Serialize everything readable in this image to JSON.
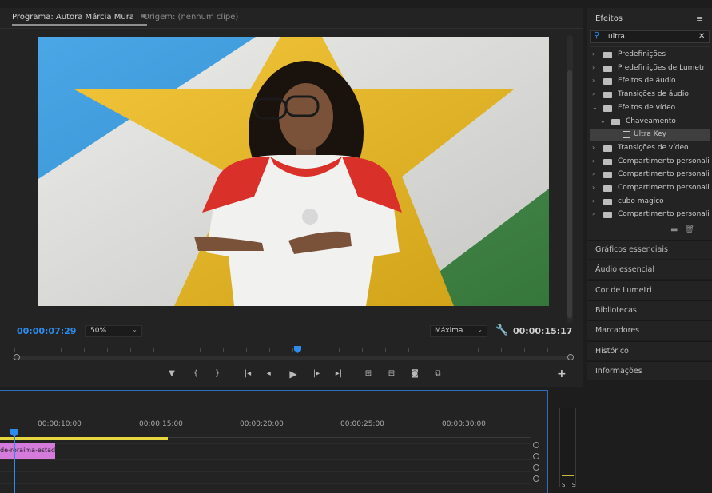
{
  "monitor": {
    "program_tab": "Programa: Autora Márcia Mura",
    "program_menu_icon": "hamburger-menu-icon",
    "source_tab": "Origem: (nenhum clipe)",
    "current_time": "00:00:07:29",
    "zoom": "50%",
    "quality": "Máxima",
    "duration": "00:00:15:17",
    "transport": {
      "icons": [
        "marker-icon",
        "mark-in-icon",
        "mark-out-icon",
        "go-to-in-icon",
        "step-back-icon",
        "play-icon",
        "step-forward-icon",
        "go-to-out-icon",
        "lift-icon",
        "extract-icon",
        "export-frame-icon",
        "comparison-view-icon"
      ],
      "add_icon": "plus-icon"
    }
  },
  "timeline": {
    "labels": [
      "00:00:10:00",
      "00:00:15:00",
      "00:00:20:00",
      "00:00:25:00",
      "00:00:30:00"
    ],
    "clip_label": "de-roraima-estado.p"
  },
  "meter": {
    "labels": "S S"
  },
  "effects": {
    "title": "Efeitos",
    "menu_icon": "hamburger-menu-icon",
    "search_value": "ultra",
    "tree": [
      {
        "label": "Predefinições",
        "depth": 0,
        "expanded": false,
        "selected": false
      },
      {
        "label": "Predefinições de Lumetri",
        "depth": 0,
        "expanded": false,
        "selected": false
      },
      {
        "label": "Efeitos de áudio",
        "depth": 0,
        "expanded": false,
        "selected": false
      },
      {
        "label": "Transições de áudio",
        "depth": 0,
        "expanded": false,
        "selected": false
      },
      {
        "label": "Efeitos de vídeo",
        "depth": 0,
        "expanded": true,
        "selected": false
      },
      {
        "label": "Chaveamento",
        "depth": 1,
        "expanded": true,
        "selected": false
      },
      {
        "label": "Ultra Key",
        "depth": 2,
        "expanded": false,
        "selected": true
      },
      {
        "label": "Transições de vídeo",
        "depth": 0,
        "expanded": false,
        "selected": false
      },
      {
        "label": "Compartimento personaliz",
        "depth": 0,
        "expanded": false,
        "selected": false
      },
      {
        "label": "Compartimento personaliz",
        "depth": 0,
        "expanded": false,
        "selected": false
      },
      {
        "label": "Compartimento personaliz",
        "depth": 0,
        "expanded": false,
        "selected": false
      },
      {
        "label": "cubo magico",
        "depth": 0,
        "expanded": false,
        "selected": false
      },
      {
        "label": "Compartimento personaliz",
        "depth": 0,
        "expanded": false,
        "selected": false
      }
    ]
  },
  "panels": [
    "Gráficos essenciais",
    "Áudio essencial",
    "Cor de Lumetri",
    "Bibliotecas",
    "Marcadores",
    "Histórico",
    "Informações"
  ],
  "colors": {
    "accent": "#2d8ceb",
    "clip": "#d57bdc",
    "work_area": "#e6d640"
  }
}
